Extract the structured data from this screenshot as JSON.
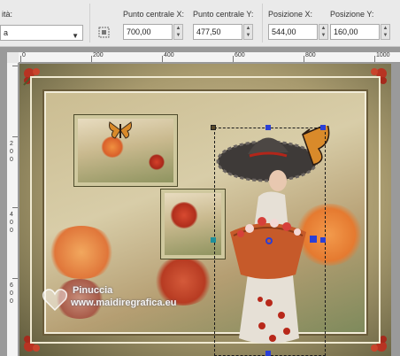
{
  "toolbar": {
    "quality_label": "ità:",
    "quality_value": "a",
    "center_x_label": "Punto centrale X:",
    "center_x_value": "700,00",
    "center_y_label": "Punto centrale Y:",
    "center_y_value": "477,50",
    "pos_x_label": "Posizione X:",
    "pos_x_value": "544,00",
    "pos_y_label": "Posizione Y:",
    "pos_y_value": "160,00"
  },
  "rulers": {
    "top": [
      "0",
      "200",
      "400",
      "600",
      "800",
      "1000"
    ],
    "left": [
      "2",
      "0",
      "0",
      "2",
      "0",
      "0",
      "4",
      "0",
      "0",
      "6",
      "0",
      "0"
    ]
  },
  "watermark": {
    "name": "Pinuccia",
    "site": "www.maidiregrafica.eu"
  },
  "colors": {
    "handle_blue": "#2a3fd6",
    "handle_teal": "#1e8f9a",
    "accent_red": "#c8311e"
  }
}
